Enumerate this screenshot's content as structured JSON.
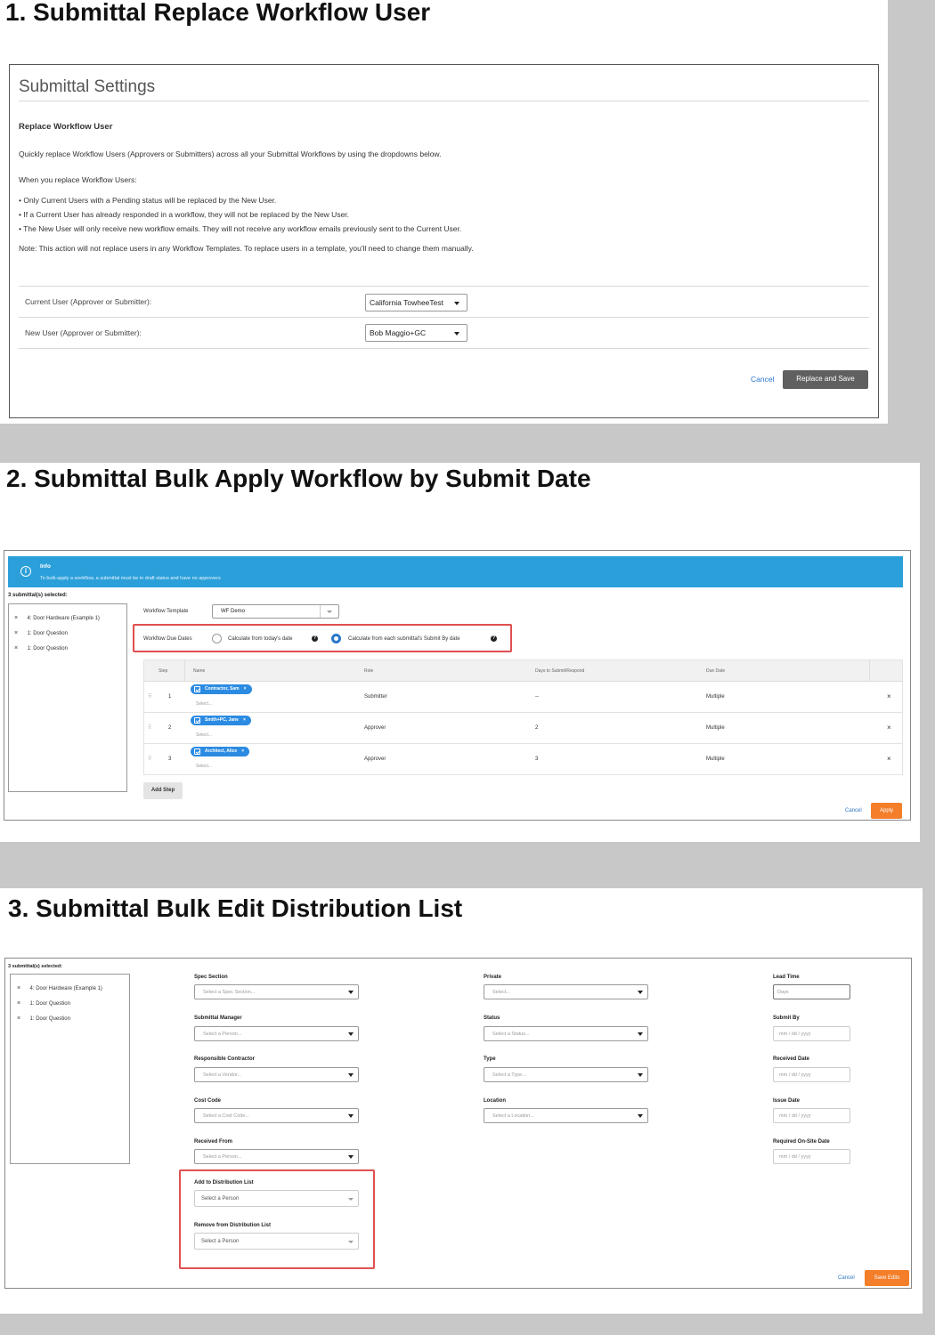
{
  "section1": {
    "heading": "1. Submittal Replace Workflow User",
    "panel_title": "Submittal Settings",
    "subtitle": "Replace Workflow User",
    "intro": "Quickly replace Workflow Users (Approvers or Submitters) across all your Submittal Workflows by using the dropdowns below.",
    "when_text": "When you replace Workflow Users:",
    "bullets": [
      "• Only Current Users with a Pending status will be replaced by the New User.",
      "• If a Current User has already responded in a workflow, they will not be replaced by the New User.",
      "• The New User will only receive new workflow emails. They will not receive any workflow emails previously sent to the Current User."
    ],
    "note": "Note: This action will not replace users in any Workflow Templates. To replace users in a template, you'll need to change them manually.",
    "current_user_label": "Current User (Approver or Submitter):",
    "current_user_value": "California TowheeTest",
    "new_user_label": "New User (Approver or Submitter):",
    "new_user_value": "Bob Maggio+GC",
    "cancel": "Cancel",
    "replace_save": "Replace and Save"
  },
  "section2": {
    "heading": "2. Submittal Bulk Apply Workflow by Submit Date",
    "info_title": "Info",
    "info_text": "To bulk-apply a workflow, a submittal must be in draft status and have no approvers",
    "selected_count": "3 submittal(s) selected:",
    "selected_items": [
      "4: Door Hardware (Example 1)",
      "1: Door Question",
      "1: Door Question"
    ],
    "workflow_template_label": "Workflow Template",
    "workflow_template_value": "WF Demo",
    "due_dates_label": "Workflow Due Dates",
    "radio_today": "Calculate from today's date",
    "radio_submit": "Calculate from each submittal's Submit By date",
    "columns": [
      "Step",
      "Name",
      "Role",
      "Days to Submit/Respond",
      "Due Date"
    ],
    "rows": [
      {
        "step": "1",
        "name": "Contractor, Sam",
        "placeholder": "Select...",
        "role": "Submitter",
        "days": "--",
        "due": "Multiple"
      },
      {
        "step": "2",
        "name": "Smith+PC, Jane",
        "placeholder": "Select...",
        "role": "Approver",
        "days": "2",
        "due": "Multiple"
      },
      {
        "step": "3",
        "name": "Architect, Alice",
        "placeholder": "Select...",
        "role": "Approver",
        "days": "3",
        "due": "Multiple"
      }
    ],
    "add_step": "Add Step",
    "cancel": "Cancel",
    "apply": "Apply"
  },
  "section3": {
    "heading": "3. Submittal Bulk Edit Distribution List",
    "selected_count": "3 submittal(s) selected:",
    "selected_items": [
      "4: Door Hardware (Example 1)",
      "1: Door Question",
      "1: Door Question"
    ],
    "col1": [
      {
        "label": "Spec Section",
        "placeholder": "Select a Spec Section..."
      },
      {
        "label": "Submittal Manager",
        "placeholder": "Select a Person..."
      },
      {
        "label": "Responsible Contractor",
        "placeholder": "Select a Vendor..."
      },
      {
        "label": "Cost Code",
        "placeholder": "Select a Cost Code..."
      },
      {
        "label": "Received From",
        "placeholder": "Select a Person..."
      }
    ],
    "add_dist_label": "Add to Distribution List",
    "add_dist_placeholder": "Select a Person",
    "remove_dist_label": "Remove from Distribution List",
    "remove_dist_placeholder": "Select a Person",
    "col2": [
      {
        "label": "Private",
        "placeholder": "Select..."
      },
      {
        "label": "Status",
        "placeholder": "Select a Status..."
      },
      {
        "label": "Type",
        "placeholder": "Select a Type..."
      },
      {
        "label": "Location",
        "placeholder": "Select a Location..."
      }
    ],
    "col3": [
      {
        "label": "Lead Time",
        "placeholder": "Days"
      },
      {
        "label": "Submit By",
        "placeholder": "mm / dd / yyyy"
      },
      {
        "label": "Received Date",
        "placeholder": "mm / dd / yyyy"
      },
      {
        "label": "Issue Date",
        "placeholder": "mm / dd / yyyy"
      },
      {
        "label": "Required On-Site Date",
        "placeholder": "mm / dd / yyyy"
      }
    ],
    "cancel": "Cancel",
    "save_edits": "Save Edits"
  },
  "colors": {
    "accent_blue": "#2b9fd9",
    "orange": "#f47e2a",
    "highlight_red": "#e05050",
    "link": "#2b77c9"
  }
}
